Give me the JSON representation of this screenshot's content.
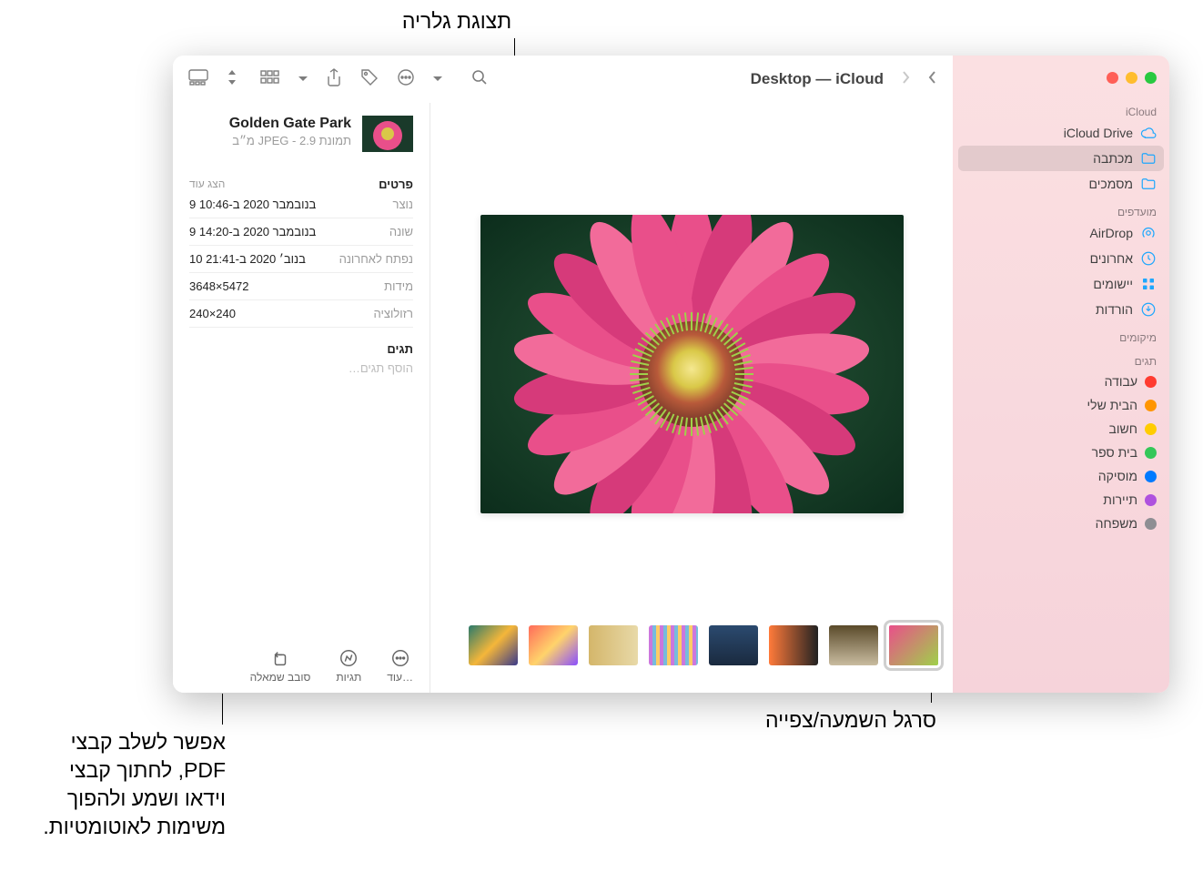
{
  "callouts": {
    "gallery_view": "תצוגת גלריה",
    "scrubber": "סרגל השמעה/צפייה",
    "more_actions": "אפשר לשלב קבצי\nPDF, לחתוך קבצי\nוידאו ושמע ולהפוך\nמשימות לאוטומטיות."
  },
  "window_title": "Desktop — iCloud",
  "sidebar": {
    "sections": {
      "icloud": "iCloud",
      "favorites": "מועדפים",
      "locations": "מיקומים",
      "tags": "תגים"
    },
    "icloud_items": [
      {
        "label": "iCloud Drive",
        "icon": "cloud"
      },
      {
        "label": "מכתבה",
        "icon": "folder",
        "selected": true
      },
      {
        "label": "מסמכים",
        "icon": "folder"
      }
    ],
    "favorites": [
      {
        "label": "AirDrop",
        "icon": "airdrop"
      },
      {
        "label": "אחרונים",
        "icon": "clock"
      },
      {
        "label": "יישומים",
        "icon": "apps"
      },
      {
        "label": "הורדות",
        "icon": "download"
      }
    ],
    "tags": [
      {
        "label": "עבודה",
        "color": "#ff3b30"
      },
      {
        "label": "הבית שלי",
        "color": "#ff9500"
      },
      {
        "label": "חשוב",
        "color": "#ffcc00"
      },
      {
        "label": "בית ספר",
        "color": "#34c759"
      },
      {
        "label": "מוסיקה",
        "color": "#007aff"
      },
      {
        "label": "תיירות",
        "color": "#af52de"
      },
      {
        "label": "משפחה",
        "color": "#8e8e93"
      }
    ]
  },
  "info": {
    "title": "Golden Gate Park",
    "subtitle": "תמונת JPEG - 2.9 מ״ב",
    "details_label": "פרטים",
    "show_more": "הצג עוד",
    "rows": [
      {
        "k": "נוצר",
        "v": "9 בנובמבר 2020 ב-10:46"
      },
      {
        "k": "שונה",
        "v": "9 בנובמבר 2020 ב-14:20"
      },
      {
        "k": "נפתח לאחרונה",
        "v": "10 בנוב׳ 2020 ב-21:41"
      },
      {
        "k": "מידות",
        "v": "3648×5472"
      },
      {
        "k": "רזולוציה",
        "v": "240×240"
      }
    ],
    "tags_label": "תגים",
    "add_tags": "הוסף תגים…"
  },
  "actions": {
    "rotate": "סובב שמאלה",
    "markup": "תגיות",
    "more": "עוד…"
  },
  "thumbs": [
    {
      "bg": "linear-gradient(135deg,#e94f8a,#9fd14a)"
    },
    {
      "bg": "linear-gradient(180deg,#5a4a2a,#c9bca0)"
    },
    {
      "bg": "linear-gradient(90deg,#ff7a3a,#222)"
    },
    {
      "bg": "linear-gradient(180deg,#2b4a6f,#1a2a3f)"
    },
    {
      "bg": "repeating-linear-gradient(90deg,#c7d 0 4px,#7bd 4px 8px,#fc6 8px 12px)"
    },
    {
      "bg": "linear-gradient(90deg,#d4b66a,#e8d9a8)"
    },
    {
      "bg": "linear-gradient(135deg,#ff6b5a,#ffd36b,#8a4fff)"
    },
    {
      "bg": "linear-gradient(135deg,#2a7a6b,#f4b63a,#3a3a8a)"
    }
  ]
}
